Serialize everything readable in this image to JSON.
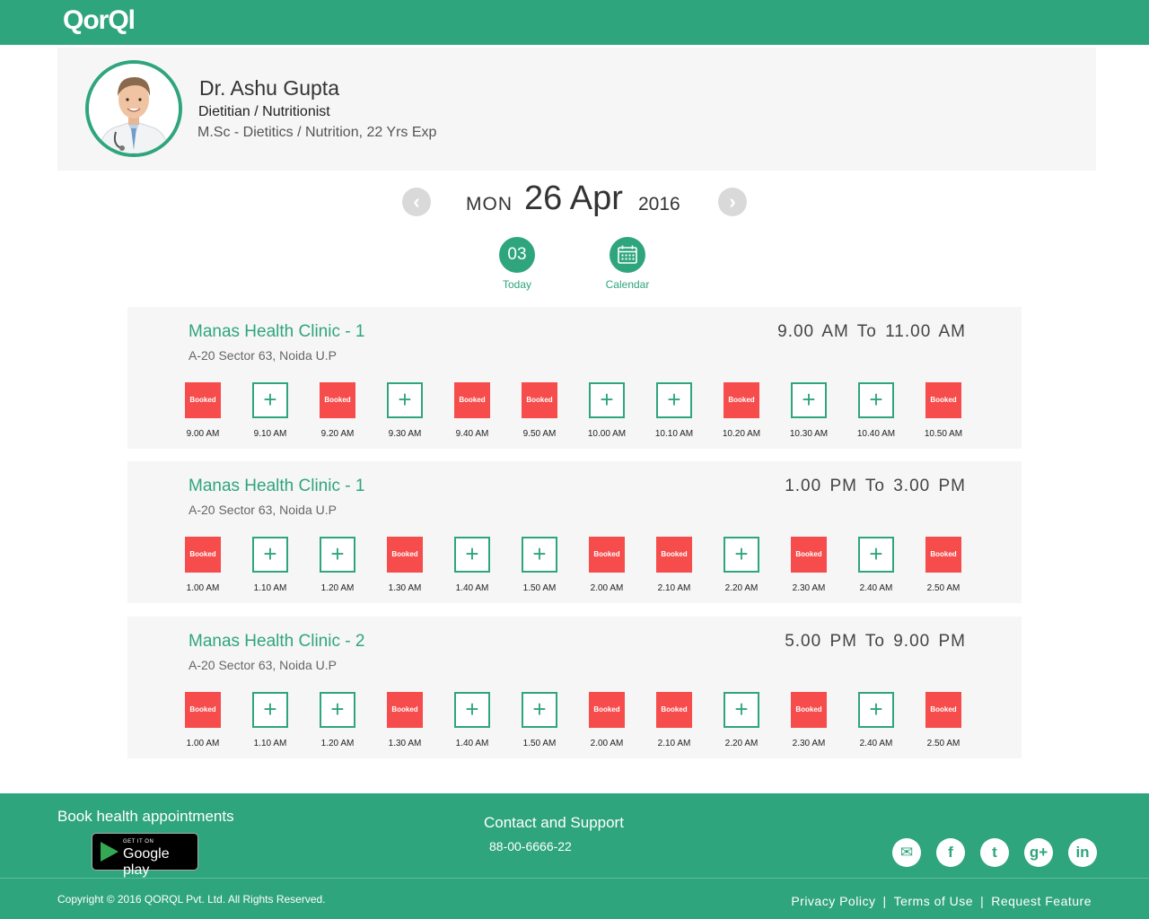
{
  "brand": {
    "logo_text": "QorQl"
  },
  "doctor": {
    "name": "Dr. Ashu Gupta",
    "specialty": "Dietitian / Nutritionist",
    "qualification": "M.Sc - Dietitics / Nutrition,  22 Yrs Exp"
  },
  "date": {
    "day": "MON",
    "date": "26 Apr",
    "year": "2016"
  },
  "quick": {
    "today_num": "03",
    "today_label": "Today",
    "calendar_label": "Calendar"
  },
  "booked_label": "Booked",
  "clinics": [
    {
      "name": "Manas Health Clinic - 1",
      "address": "A-20 Sector 63, Noida U.P",
      "time_range": "9.00 AM  To  11.00 AM",
      "slots": [
        {
          "time": "9.00 AM",
          "booked": true
        },
        {
          "time": "9.10 AM",
          "booked": false
        },
        {
          "time": "9.20 AM",
          "booked": true
        },
        {
          "time": "9.30 AM",
          "booked": false
        },
        {
          "time": "9.40 AM",
          "booked": true
        },
        {
          "time": "9.50 AM",
          "booked": true
        },
        {
          "time": "10.00 AM",
          "booked": false
        },
        {
          "time": "10.10 AM",
          "booked": false
        },
        {
          "time": "10.20 AM",
          "booked": true
        },
        {
          "time": "10.30 AM",
          "booked": false
        },
        {
          "time": "10.40 AM",
          "booked": false
        },
        {
          "time": "10.50 AM",
          "booked": true
        }
      ]
    },
    {
      "name": "Manas Health Clinic - 1",
      "address": "A-20 Sector 63, Noida U.P",
      "time_range": "1.00 PM  To  3.00 PM",
      "slots": [
        {
          "time": "1.00 AM",
          "booked": true
        },
        {
          "time": "1.10 AM",
          "booked": false
        },
        {
          "time": "1.20 AM",
          "booked": false
        },
        {
          "time": "1.30 AM",
          "booked": true
        },
        {
          "time": "1.40 AM",
          "booked": false
        },
        {
          "time": "1.50 AM",
          "booked": false
        },
        {
          "time": "2.00 AM",
          "booked": true
        },
        {
          "time": "2.10 AM",
          "booked": true
        },
        {
          "time": "2.20 AM",
          "booked": false
        },
        {
          "time": "2.30 AM",
          "booked": true
        },
        {
          "time": "2.40 AM",
          "booked": false
        },
        {
          "time": "2.50 AM",
          "booked": true
        }
      ]
    },
    {
      "name": "Manas Health Clinic - 2",
      "address": "A-20 Sector 63, Noida U.P",
      "time_range": "5.00 PM  To  9.00 PM",
      "slots": [
        {
          "time": "1.00 AM",
          "booked": true
        },
        {
          "time": "1.10 AM",
          "booked": false
        },
        {
          "time": "1.20 AM",
          "booked": false
        },
        {
          "time": "1.30 AM",
          "booked": true
        },
        {
          "time": "1.40 AM",
          "booked": false
        },
        {
          "time": "1.50 AM",
          "booked": false
        },
        {
          "time": "2.00 AM",
          "booked": true
        },
        {
          "time": "2.10 AM",
          "booked": true
        },
        {
          "time": "2.20 AM",
          "booked": false
        },
        {
          "time": "2.30 AM",
          "booked": true
        },
        {
          "time": "2.40 AM",
          "booked": false
        },
        {
          "time": "2.50 AM",
          "booked": true
        }
      ]
    }
  ],
  "footer": {
    "book_title": "Book health appointments",
    "google_play_small": "GET IT ON",
    "google_play_big": "Google play",
    "contact_title": "Contact and Support",
    "phone": "88-00-6666-22",
    "socials": [
      {
        "name": "mail",
        "glyph": "✉"
      },
      {
        "name": "facebook",
        "glyph": "f"
      },
      {
        "name": "twitter",
        "glyph": "t"
      },
      {
        "name": "google-plus",
        "glyph": "g+"
      },
      {
        "name": "linkedin",
        "glyph": "in"
      }
    ],
    "copyright": "Copyright © 2016 QORQL Pvt. Ltd. All Rights Reserved.",
    "links": [
      "Privacy Policy",
      "Terms of Use",
      "Request Feature"
    ]
  },
  "colors": {
    "brand": "#2fa57d",
    "booked": "#f64c4c",
    "panel": "#f6f6f6"
  }
}
